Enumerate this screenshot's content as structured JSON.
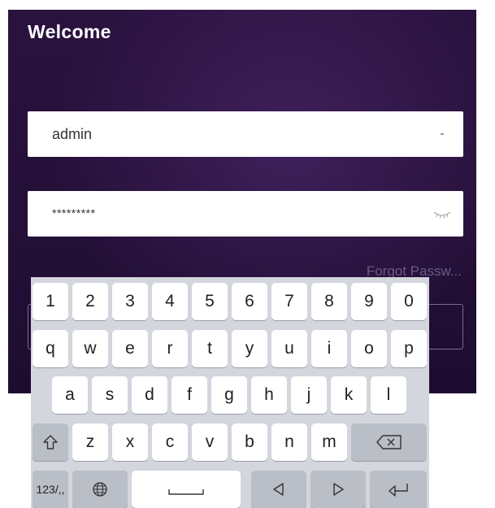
{
  "app": {
    "title": "Welcome"
  },
  "login": {
    "username_value": "admin",
    "password_value": "*********",
    "forgot_password_label": "Forgot Passw..."
  },
  "keyboard": {
    "row1": [
      "1",
      "2",
      "3",
      "4",
      "5",
      "6",
      "7",
      "8",
      "9",
      "0"
    ],
    "row2": [
      "q",
      "w",
      "e",
      "r",
      "t",
      "y",
      "u",
      "i",
      "o",
      "p"
    ],
    "row3": [
      "a",
      "s",
      "d",
      "f",
      "g",
      "h",
      "j",
      "k",
      "l"
    ],
    "row4": [
      "z",
      "x",
      "c",
      "v",
      "b",
      "n",
      "m"
    ],
    "mode_key_label": "123/,,"
  },
  "colors": {
    "background": "#241038",
    "field": "#ffffff",
    "forgot_text": "#6b5a82",
    "keyboard_bg": "#d3d6dc",
    "key": "#ffffff",
    "function_key": "#b9bec7"
  },
  "icons": {
    "username_trailing": "dropdown-icon",
    "password_trailing": "eye-closed-icon",
    "shift": "shift-icon",
    "backspace": "backspace-icon",
    "globe": "globe-icon",
    "space": "space-bar-icon",
    "left": "arrow-left-icon",
    "right": "arrow-right-icon",
    "enter": "enter-icon"
  }
}
